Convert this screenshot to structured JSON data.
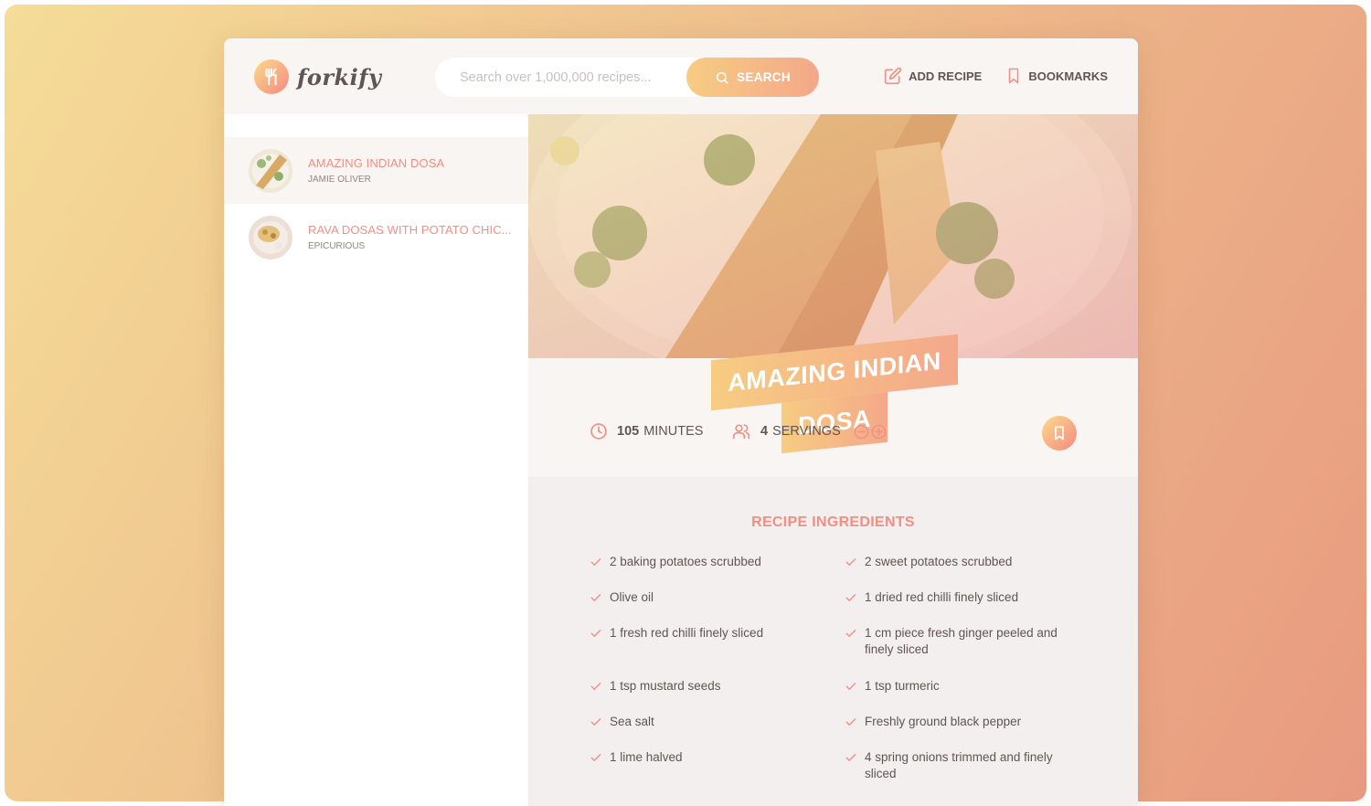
{
  "app": {
    "logo_text": "forkify"
  },
  "search": {
    "placeholder": "Search over 1,000,000 recipes...",
    "button_label": "SEARCH"
  },
  "nav": {
    "add_recipe": "ADD RECIPE",
    "bookmarks": "BOOKMARKS"
  },
  "results": [
    {
      "title": "AMAZING INDIAN DOSA",
      "publisher": "JAMIE OLIVER",
      "active": true
    },
    {
      "title": "RAVA DOSAS WITH POTATO CHIC...",
      "publisher": "EPICURIOUS",
      "active": false
    }
  ],
  "recipe": {
    "title_line1": "AMAZING INDIAN",
    "title_line2": "DOSA",
    "cooking_time": "105",
    "cooking_time_unit": "MINUTES",
    "servings": "4",
    "servings_unit": "SERVINGS"
  },
  "ingredients": {
    "heading": "RECIPE INGREDIENTS",
    "left": [
      "2 baking potatoes scrubbed",
      "Olive oil",
      "1 fresh red chilli finely sliced",
      "1 tsp mustard seeds",
      "Sea salt",
      "1 lime halved"
    ],
    "right": [
      "2 sweet potatoes scrubbed",
      "1 dried red chilli finely sliced",
      "1 cm piece fresh ginger peeled and finely sliced",
      "1 tsp turmeric",
      "Freshly ground black pepper",
      "4 spring onions trimmed and finely sliced"
    ]
  },
  "colors": {
    "accent": "#f38e82",
    "gradient_start": "#fbdb89",
    "gradient_end": "#f48982",
    "text": "#615551"
  },
  "icons": [
    "fork-knife-icon",
    "search-icon",
    "edit-icon",
    "bookmark-icon",
    "clock-icon",
    "users-icon",
    "minus-circle-icon",
    "plus-circle-icon",
    "check-icon"
  ]
}
